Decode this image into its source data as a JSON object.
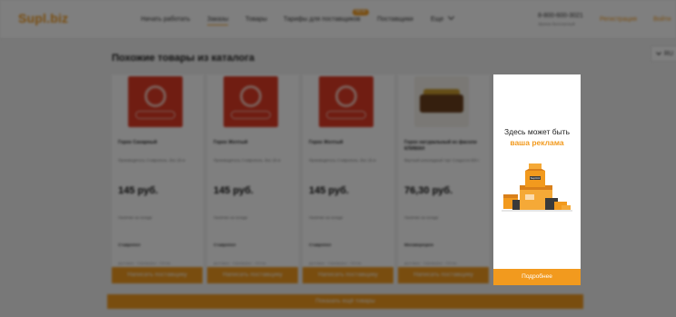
{
  "header": {
    "logo": "Supl.biz",
    "nav": [
      "Начать работать",
      "Заказы",
      "Товары",
      "Тарифы для поставщиков",
      "Поставщики",
      "Еще"
    ],
    "new_badge": "NEW",
    "phone": "8-800-600-3021",
    "phone_note": "Звонок бесплатный",
    "register": "Регистрация",
    "login": "Войти",
    "lang": "RU"
  },
  "section": {
    "title": "Похожие товары из каталога"
  },
  "products": [
    {
      "name": "Горох Сахарный",
      "desc": "Производитель Ставрополь. Вес 25 кг",
      "price": "145 руб.",
      "stock": "Наличие на складе",
      "supplier": "Ставропол",
      "extra": "Доставка · Самовывоз · Оптом"
    },
    {
      "name": "Горох Желтый",
      "desc": "Производитель Ставрополь. Вес 25 кг",
      "price": "145 руб.",
      "stock": "Наличие на складе",
      "supplier": "Ставропол",
      "extra": "Доставка · Самовывоз · Оптом"
    },
    {
      "name": "Горох Желтый",
      "desc": "Производитель Ставрополь. Вес 25 кг",
      "price": "145 руб.",
      "stock": "Наличие на складе",
      "supplier": "Ставропол",
      "extra": "Доставка · Самовывоз · Оптом"
    },
    {
      "name": "Горох натуральный из фасоли КЛИМАН",
      "desc": "Вкусный шоколадный торт Сладости 500 г",
      "price": "76,30 руб.",
      "stock": "Наличие на складе",
      "supplier": "Москворецкое",
      "extra": "Доставка · Самовывоз · Оптом"
    }
  ],
  "contact_button": "Написать поставщику",
  "more_button": "Показать ещё товары",
  "ad": {
    "line1": "Здесь может быть",
    "line2": "ваша реклама",
    "box_label": "Supl.biz",
    "button": "Подробнее"
  },
  "colors": {
    "accent": "#f29a1e",
    "overlay": "rgba(0,0,0,0.5)"
  }
}
